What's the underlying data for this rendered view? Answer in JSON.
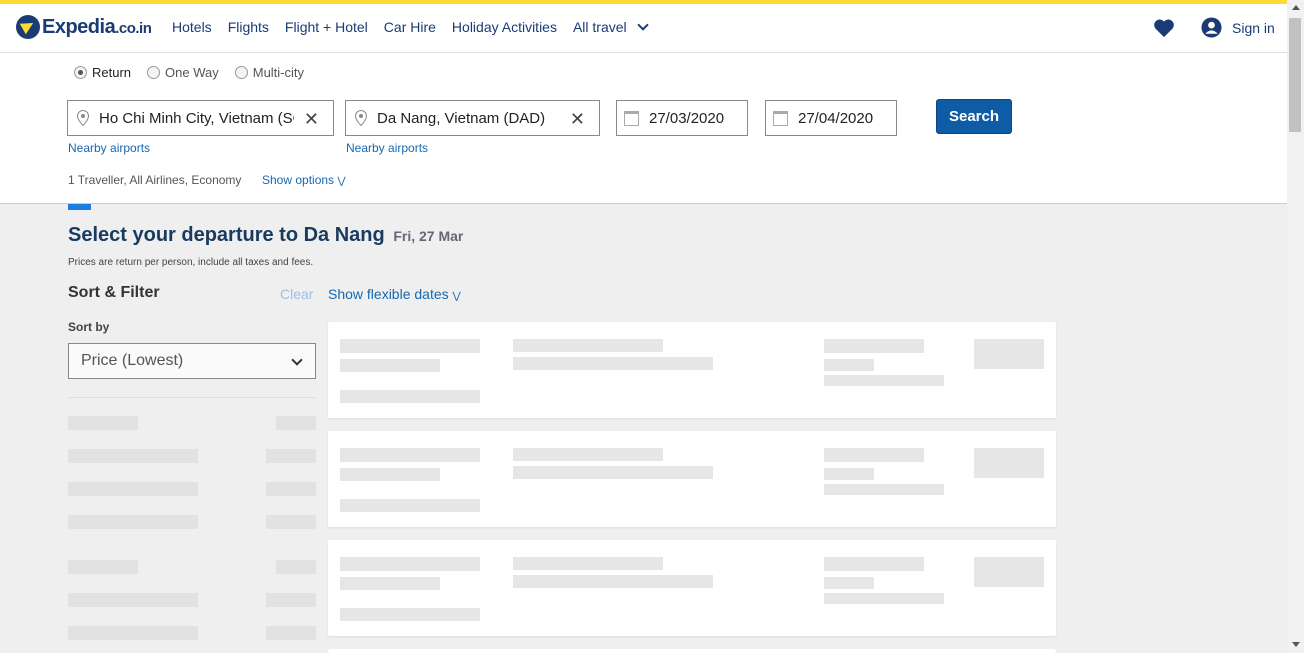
{
  "brand": {
    "name": "Expedia",
    "suffix": ".co.in"
  },
  "nav": {
    "items": [
      "Hotels",
      "Flights",
      "Flight + Hotel",
      "Car Hire",
      "Holiday Activities"
    ],
    "all_travel": "All travel",
    "sign_in": "Sign in"
  },
  "search": {
    "trip_types": [
      {
        "label": "Return",
        "selected": true
      },
      {
        "label": "One Way",
        "selected": false
      },
      {
        "label": "Multi-city",
        "selected": false
      }
    ],
    "origin": "Ho Chi Minh City, Vietnam (SGN)",
    "destination": "Da Nang, Vietnam (DAD)",
    "depart_date": "27/03/2020",
    "return_date": "27/04/2020",
    "search_label": "Search",
    "nearby_label": "Nearby airports",
    "traveller_summary": "1 Traveller, All Airlines, Economy",
    "show_options": "Show options"
  },
  "results": {
    "title": "Select your departure to Da Nang",
    "date": "Fri, 27 Mar",
    "price_note": "Prices are return per person, include all taxes and fees.",
    "sort_filter": "Sort & Filter",
    "clear": "Clear",
    "flexible_dates": "Show flexible dates",
    "sort_by_label": "Sort by",
    "sort_value": "Price (Lowest)"
  },
  "colors": {
    "accent_bar": "#fddb32",
    "brand_navy": "#1a3b73",
    "link_blue": "#1668b2",
    "search_button": "#0e5ba6"
  }
}
